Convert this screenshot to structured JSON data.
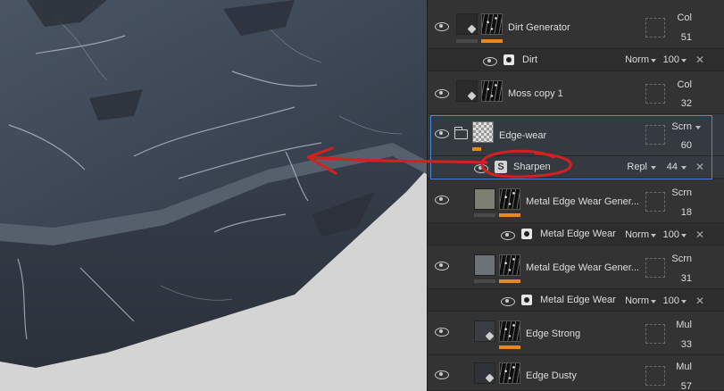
{
  "layers": [
    {
      "name": "Dirt Generator",
      "blend": "Col",
      "opacity": "51"
    },
    {
      "effect": true,
      "name": "Dirt",
      "mode": "Norm",
      "value": "100"
    },
    {
      "name": "Moss copy 1",
      "blend": "Col",
      "opacity": "32"
    },
    {
      "name": "Edge-wear",
      "blend": "Scrn",
      "opacity": "60",
      "folder": true
    },
    {
      "effect": true,
      "name": "Sharpen",
      "mode": "Repl",
      "value": "44"
    },
    {
      "name": "Metal Edge Wear Gener...",
      "blend": "Scrn",
      "opacity": "18"
    },
    {
      "effect": true,
      "name": "Metal Edge Wear",
      "mode": "Norm",
      "value": "100"
    },
    {
      "name": "Metal Edge Wear Gener...",
      "blend": "Scrn",
      "opacity": "31"
    },
    {
      "effect": true,
      "name": "Metal Edge Wear",
      "mode": "Norm",
      "value": "100"
    },
    {
      "name": "Edge Strong",
      "blend": "Mul",
      "opacity": "33"
    },
    {
      "name": "Edge Dusty",
      "blend": "Mul",
      "opacity": "57"
    }
  ],
  "colors": {
    "accent_orange": "#e8891f",
    "selection_blue": "#4a8ad6",
    "annotation_red": "#d42020"
  },
  "icons": {
    "visibility": "eye-icon",
    "folder": "folder-icon",
    "fill_mask": "paint-bucket-icon",
    "effect_filter": "filter-circle-icon",
    "sharpen_filter": "substance-s-icon",
    "remove": "close-icon"
  }
}
